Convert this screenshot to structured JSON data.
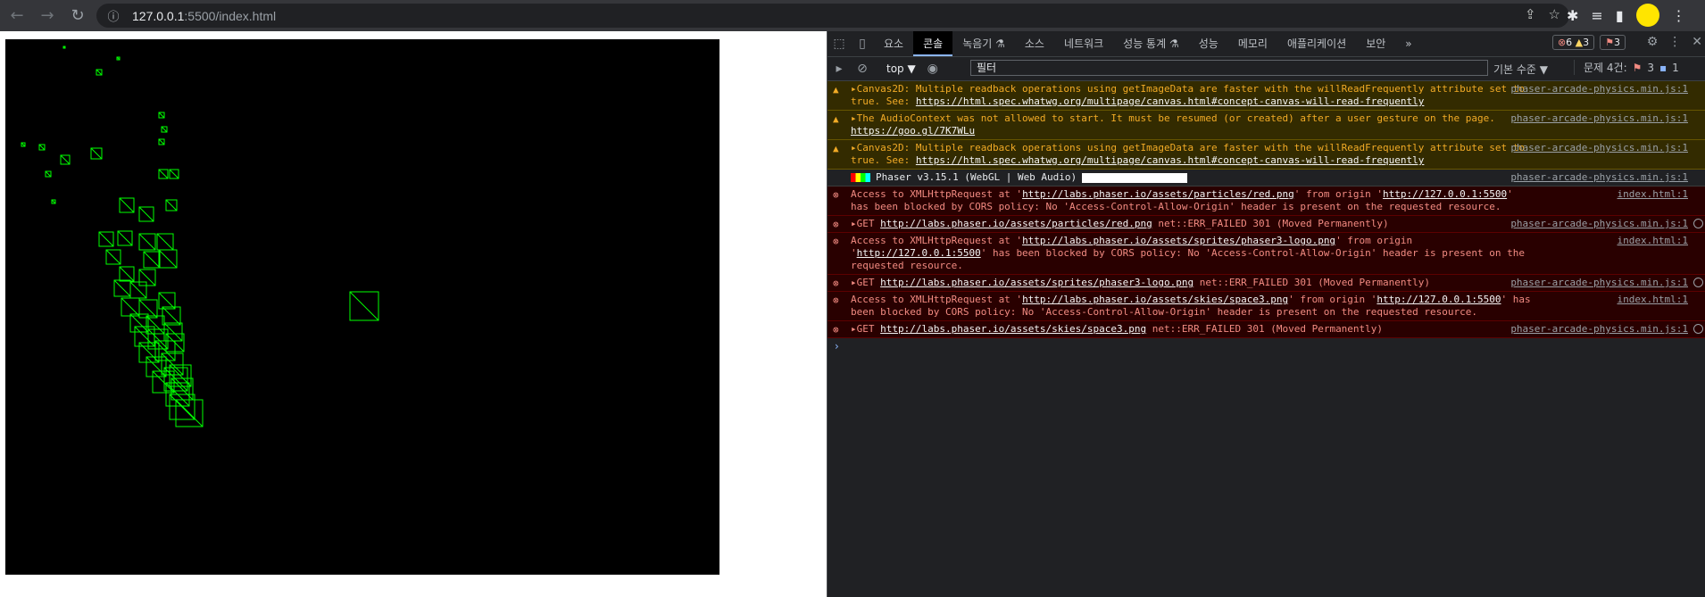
{
  "browser": {
    "url_host": "127.0.0.1",
    "url_rest": ":5500/index.html"
  },
  "devtools": {
    "tabs": [
      "요소",
      "콘솔",
      "녹음기 ⚗",
      "소스",
      "네트워크",
      "성능 통계 ⚗",
      "성능",
      "메모리",
      "애플리케이션",
      "보안"
    ],
    "active_tab": 1,
    "more": "»",
    "badge_errors": "6",
    "badge_warnings": "3",
    "badge_issues": "3",
    "context": "top ▼",
    "filter_placeholder": "필터",
    "level": "기본 수준 ▼",
    "issues_label": "문제 4건:",
    "issues_errors": "3",
    "issues_info": "1"
  },
  "console": {
    "messages": [
      {
        "level": "warn",
        "parts": [
          {
            "t": "▸Canvas2D: Multiple readback operations using getImageData are faster with the willReadFrequently attribute set to true. See: "
          },
          {
            "l": "https://html.spec.whatwg.org/multipage/canvas.html#concept-canvas-will-read-frequently"
          }
        ],
        "source": "phaser-arcade-physics.min.js:1"
      },
      {
        "level": "warn",
        "parts": [
          {
            "t": "▸The AudioContext was not allowed to start. It must be resumed (or created) after a user gesture on the page. "
          },
          {
            "l": "https://goo.gl/7K7WLu"
          }
        ],
        "source": "phaser-arcade-physics.min.js:1"
      },
      {
        "level": "warn",
        "parts": [
          {
            "t": "▸Canvas2D: Multiple readback operations using getImageData are faster with the willReadFrequently attribute set to true. See: "
          },
          {
            "l": "https://html.spec.whatwg.org/multipage/canvas.html#concept-canvas-will-read-frequently"
          }
        ],
        "source": "phaser-arcade-physics.min.js:1"
      },
      {
        "level": "info",
        "phaser": true,
        "parts": [
          {
            "t": "Phaser v3.15.1 (WebGL | Web Audio)"
          }
        ],
        "source": "phaser-arcade-physics.min.js:1"
      },
      {
        "level": "error",
        "parts": [
          {
            "t": "Access to XMLHttpRequest at '"
          },
          {
            "l": "http://labs.phaser.io/assets/particles/red.png"
          },
          {
            "t": "' from origin '"
          },
          {
            "l": "http://127.0.0.1:5500"
          },
          {
            "t": "' has been blocked by CORS policy: No 'Access-Control-Allow-Origin' header is present on the requested resource."
          }
        ],
        "source": "index.html:1"
      },
      {
        "level": "error",
        "globe": true,
        "parts": [
          {
            "t": "▸GET "
          },
          {
            "l": "http://labs.phaser.io/assets/particles/red.png"
          },
          {
            "t": " net::ERR_FAILED 301 (Moved Permanently)"
          }
        ],
        "source": "phaser-arcade-physics.min.js:1"
      },
      {
        "level": "error",
        "parts": [
          {
            "t": "Access to XMLHttpRequest at '"
          },
          {
            "l": "http://labs.phaser.io/assets/sprites/phaser3-logo.png"
          },
          {
            "t": "' from origin '"
          },
          {
            "l": "http://127.0.0.1:5500"
          },
          {
            "t": "' has been blocked by CORS policy: No 'Access-Control-Allow-Origin' header is present on the requested resource."
          }
        ],
        "source": "index.html:1"
      },
      {
        "level": "error",
        "globe": true,
        "parts": [
          {
            "t": "▸GET "
          },
          {
            "l": "http://labs.phaser.io/assets/sprites/phaser3-logo.png"
          },
          {
            "t": " net::ERR_FAILED 301 (Moved Permanently)"
          }
        ],
        "source": "phaser-arcade-physics.min.js:1"
      },
      {
        "level": "error",
        "parts": [
          {
            "t": "Access to XMLHttpRequest at '"
          },
          {
            "l": "http://labs.phaser.io/assets/skies/space3.png"
          },
          {
            "t": "' from origin '"
          },
          {
            "l": "http://127.0.0.1:5500"
          },
          {
            "t": "' has been blocked by CORS policy: No 'Access-Control-Allow-Origin' header is present on the requested resource."
          }
        ],
        "source": "index.html:1"
      },
      {
        "level": "error",
        "globe": true,
        "parts": [
          {
            "t": "▸GET "
          },
          {
            "l": "http://labs.phaser.io/assets/skies/space3.png"
          },
          {
            "t": " net::ERR_FAILED 301 (Moved Permanently)"
          }
        ],
        "source": "phaser-arcade-physics.min.js:1"
      }
    ],
    "prompt": "›"
  },
  "colors": {
    "debug_box": "#00ff00",
    "game_bg": "#000000"
  }
}
